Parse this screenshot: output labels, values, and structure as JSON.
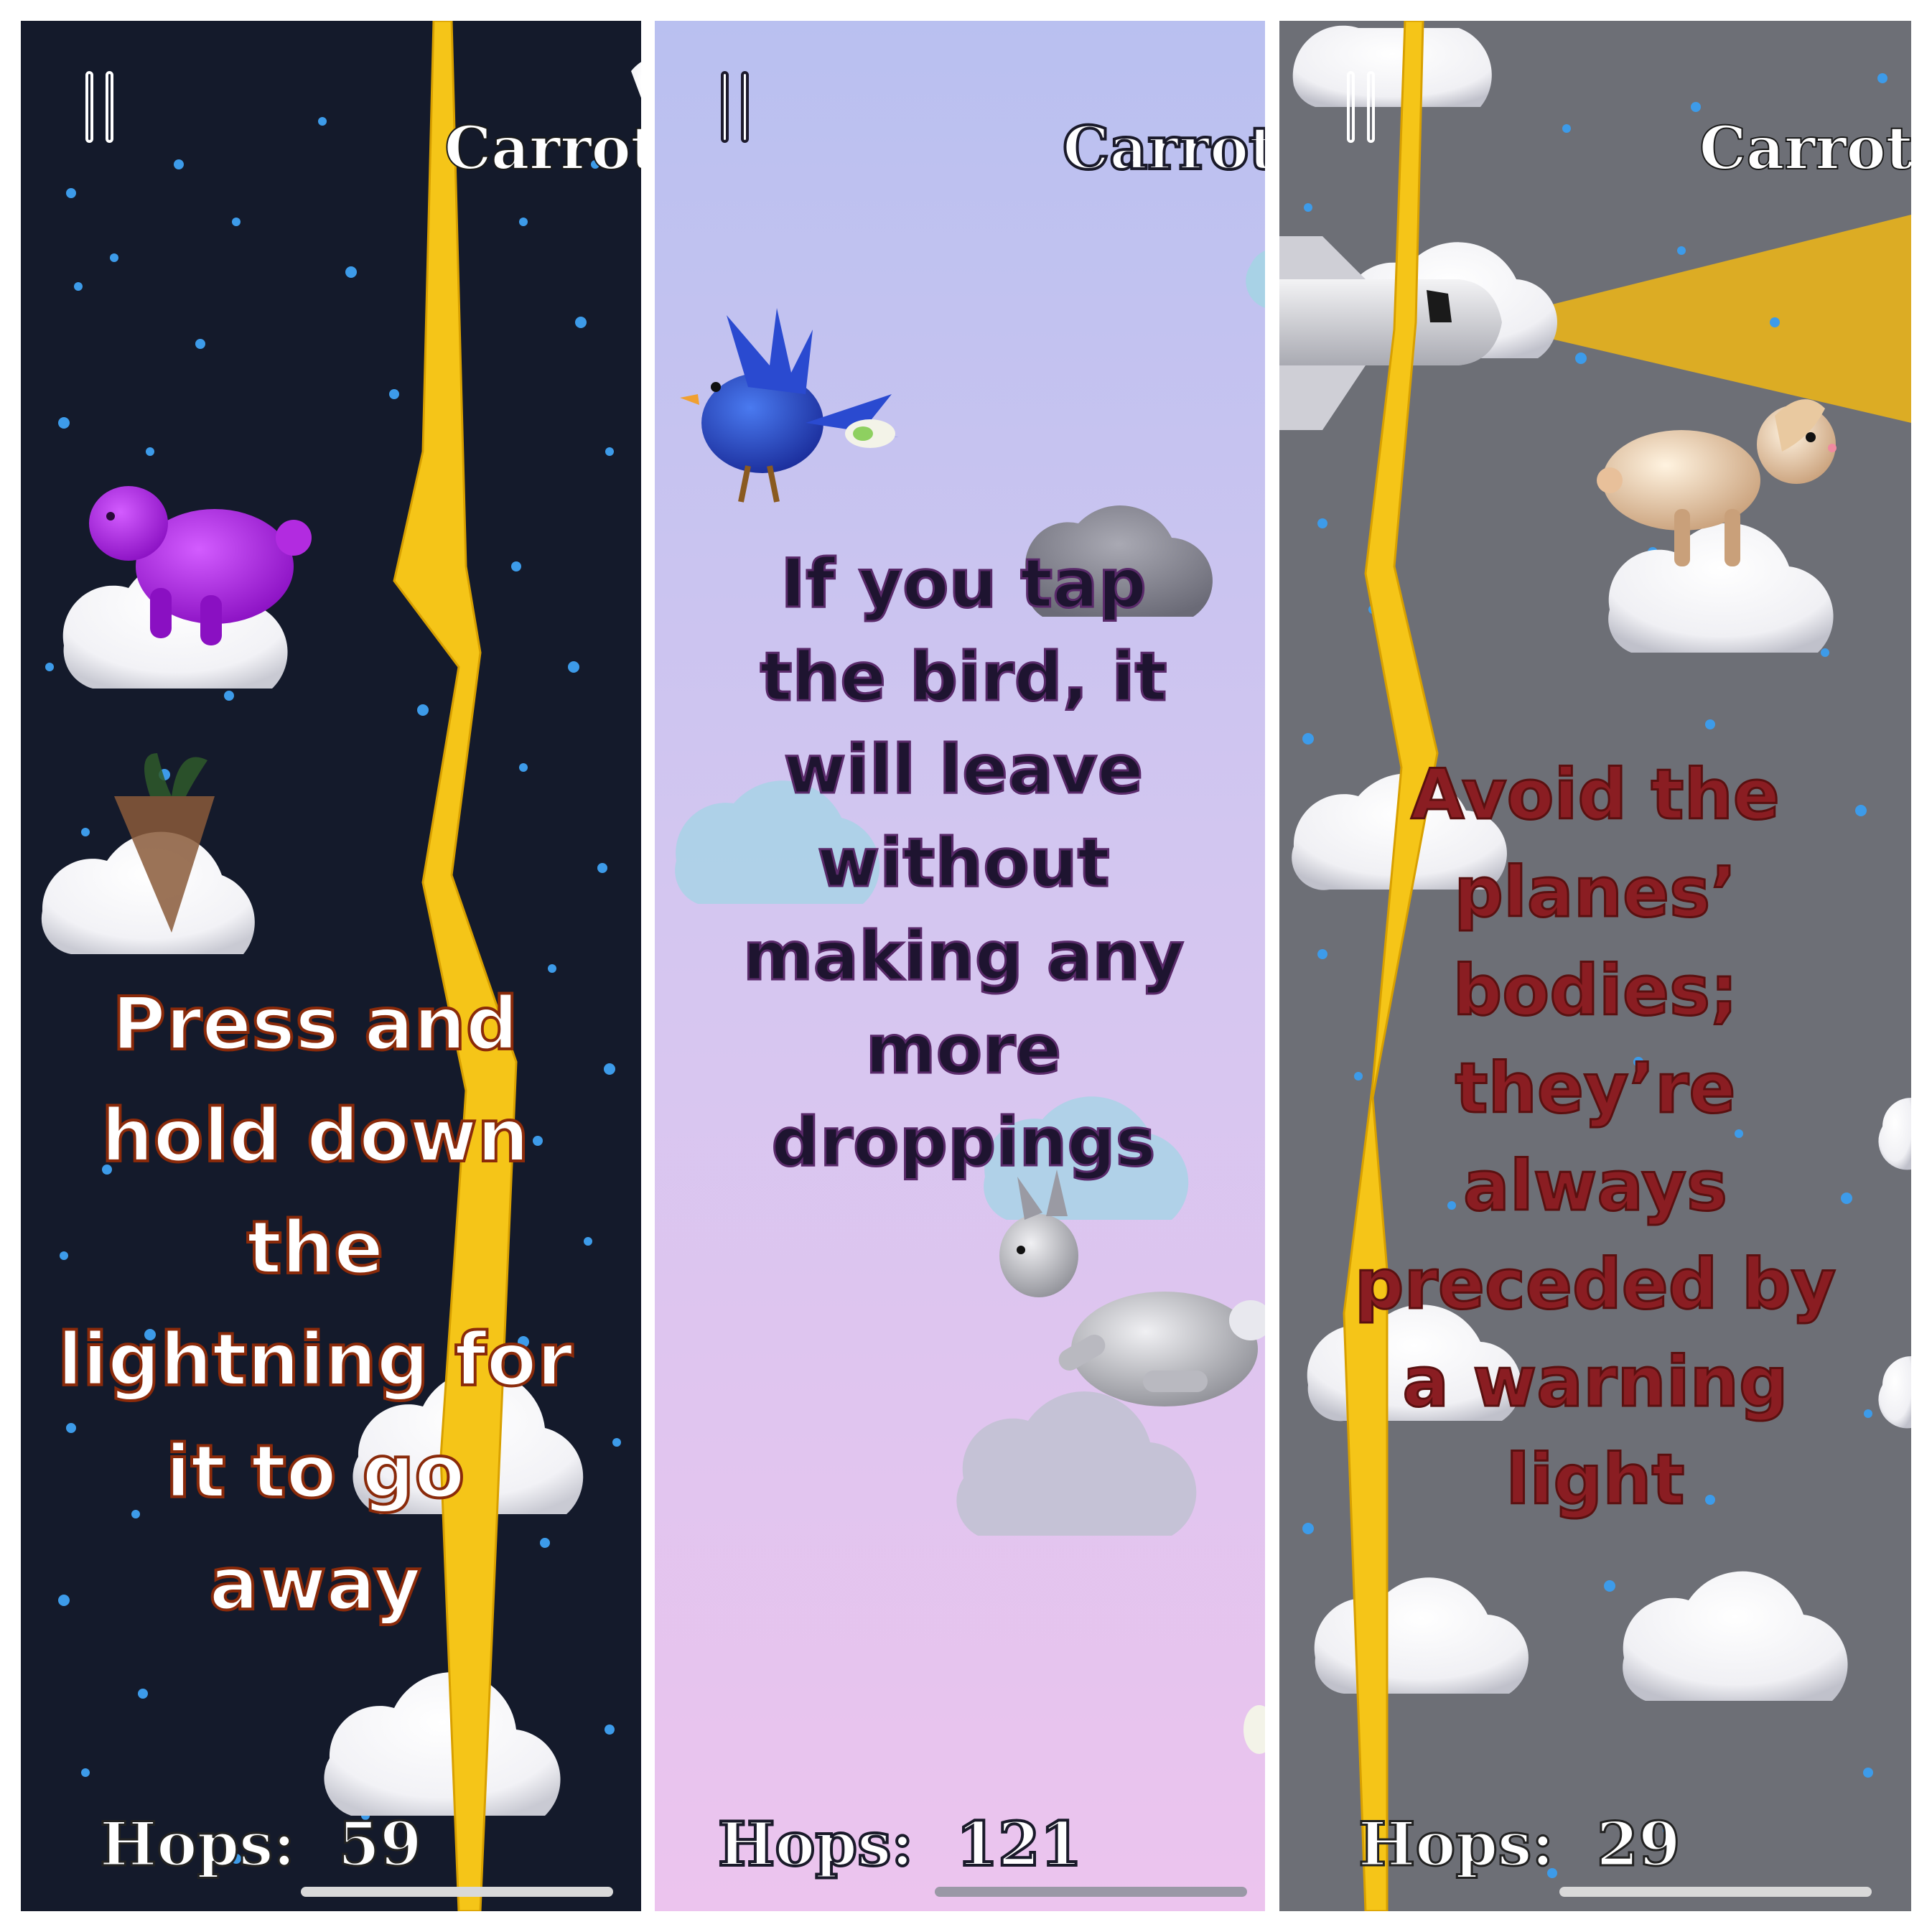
{
  "panels": [
    {
      "hud": {
        "carrots_label": "Carrots",
        "hops_label": "Hops:",
        "hops_value": "59"
      },
      "hint": "Press and hold down the lightning for it to go away"
    },
    {
      "hud": {
        "carrots_label": "Carrots",
        "hops_label": "Hops:",
        "hops_value": "121"
      },
      "hint": "If you tap the bird, it will leave without making any more droppings"
    },
    {
      "hud": {
        "carrots_label": "Carrots",
        "hops_label": "Hops:",
        "hops_value": "29"
      },
      "hint": "Avoid the planes’ bodies; they’re always preceded by a warning light"
    }
  ],
  "icons": [
    "pause-icon",
    "lightning-bolt",
    "cloud",
    "bunny",
    "carrot",
    "bird",
    "airplane",
    "warning-light-beam",
    "snow-particles"
  ],
  "colors": {
    "panel1_bg": "#141a2b",
    "panel3_bg": "#6d6f76",
    "lightning": "#f5c518",
    "hint1_text": "#ffffff",
    "hint1_outline": "#8a2a0a",
    "hint2_text": "#1e1430",
    "hint3_text": "#8a1d22",
    "snow": "#3d9be9"
  }
}
